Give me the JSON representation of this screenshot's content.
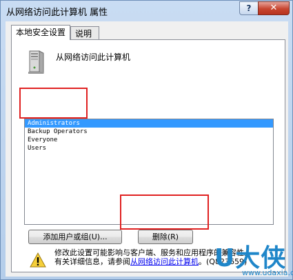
{
  "window": {
    "title": "从网络访问此计算机 属性"
  },
  "titlebar": {
    "help_glyph": "?",
    "close_glyph": "✕"
  },
  "tabs": [
    {
      "label": "本地安全设置",
      "active": true
    },
    {
      "label": "说明",
      "active": false
    }
  ],
  "policy": {
    "name": "从网络访问此计算机",
    "icon": "computer-icon"
  },
  "list": {
    "items": [
      {
        "label": "Administrators",
        "selected": true
      },
      {
        "label": "Backup Operators",
        "selected": false
      },
      {
        "label": "Everyone",
        "selected": false
      },
      {
        "label": "Users",
        "selected": false
      }
    ]
  },
  "buttons": {
    "add_label": "添加用户或组(U)...",
    "remove_label": "删除(R)"
  },
  "warning": {
    "icon": "warning-icon",
    "line1": "修改此设置可能影响与客户端、服务和应用程序的兼容性。",
    "line2_prefix": "有关详细信息，请参阅",
    "link_text": "从网络访问此计算机",
    "line2_suffix": "。(Q823659)"
  },
  "watermark": {
    "big": "U大侠",
    "small": "www.udaxia.com"
  },
  "colors": {
    "selection": "#3399ff",
    "highlight_box": "#e02020",
    "watermark": "#1f86c9"
  }
}
